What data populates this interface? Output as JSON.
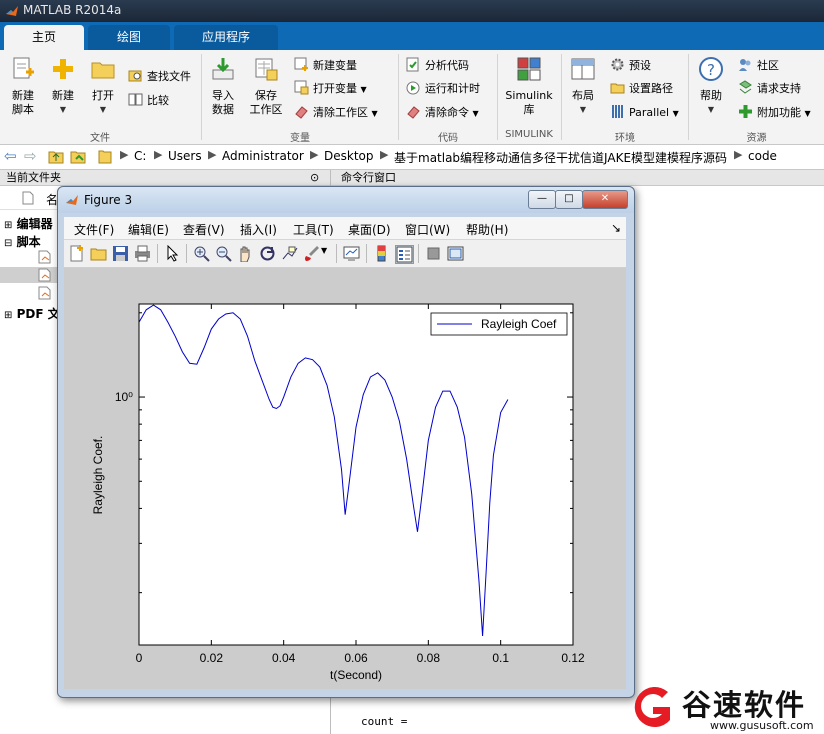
{
  "app": {
    "title": "MATLAB R2014a"
  },
  "ribbon_tabs": [
    "主页",
    "绘图",
    "应用程序"
  ],
  "ribbon": {
    "file": {
      "group": "文件",
      "new_script": [
        "新建",
        "脚本"
      ],
      "new": "新建",
      "open": "打开",
      "find_files": "查找文件",
      "compare": "比较"
    },
    "variable": {
      "group": "变量",
      "import": [
        "导入",
        "数据"
      ],
      "save_ws": [
        "保存",
        "工作区"
      ],
      "new_var": "新建变量",
      "open_var": "打开变量",
      "clear_ws": "清除工作区"
    },
    "code": {
      "group": "代码",
      "analyze": "分析代码",
      "run_time": "运行和计时",
      "clear_cmd": "清除命令"
    },
    "simulink": {
      "group": "SIMULINK",
      "lib": [
        "Simulink",
        "库"
      ]
    },
    "env": {
      "group": "环境",
      "layout": "布局",
      "prefs": "预设",
      "set_path": "设置路径",
      "parallel": "Parallel"
    },
    "resources": {
      "group": "资源",
      "help": "帮助",
      "community": "社区",
      "support": "请求支持",
      "addons": "附加功能"
    }
  },
  "address": [
    "C:",
    "Users",
    "Administrator",
    "Desktop",
    "基于matlab编程移动通信多径干扰信道JAKE模型建模程序源码",
    "code"
  ],
  "left_panel": {
    "header": "当前文件夹",
    "col_name": "名",
    "tree": [
      "编辑器",
      "脚本",
      "PDF 文"
    ]
  },
  "cmd_panel": {
    "header": "命令行窗口",
    "line": "count  ="
  },
  "figure": {
    "title": "Figure 3",
    "menus": [
      "文件(F)",
      "编辑(E)",
      "查看(V)",
      "插入(I)",
      "工具(T)",
      "桌面(D)",
      "窗口(W)",
      "帮助(H)"
    ],
    "menu_arrow": "↘",
    "window_buttons": [
      "—",
      "□",
      "✕"
    ]
  },
  "chart_data": {
    "type": "line",
    "title": "",
    "xlabel": "t(Second)",
    "ylabel": "Rayleigh Coef.",
    "yscale": "log",
    "xlim": [
      0,
      0.12
    ],
    "ylim": [
      0.13,
      2.15
    ],
    "xticks": [
      0,
      0.02,
      0.04,
      0.06,
      0.08,
      0.1,
      0.12
    ],
    "xtick_labels": [
      "0",
      "0.02",
      "0.04",
      "0.06",
      "0.08",
      "0.1",
      "0.12"
    ],
    "yticks": [
      1
    ],
    "ytick_labels": [
      "10⁰"
    ],
    "grid": false,
    "legend_position": "top-right",
    "series": [
      {
        "name": "Rayleigh Coef",
        "color": "#0000cc",
        "x": [
          0,
          0.002,
          0.004,
          0.006,
          0.008,
          0.01,
          0.012,
          0.014,
          0.016,
          0.018,
          0.02,
          0.022,
          0.024,
          0.026,
          0.028,
          0.03,
          0.032,
          0.034,
          0.036,
          0.037,
          0.038,
          0.039,
          0.04,
          0.042,
          0.044,
          0.046,
          0.048,
          0.05,
          0.052,
          0.054,
          0.056,
          0.057,
          0.058,
          0.06,
          0.062,
          0.064,
          0.066,
          0.068,
          0.07,
          0.072,
          0.074,
          0.076,
          0.077,
          0.078,
          0.08,
          0.082,
          0.084,
          0.086,
          0.088,
          0.09,
          0.092,
          0.094,
          0.095,
          0.096,
          0.097,
          0.098,
          0.1,
          0.102
        ],
        "y": [
          1.85,
          2.05,
          2.13,
          2.05,
          1.85,
          1.65,
          1.45,
          1.32,
          1.31,
          1.5,
          1.75,
          1.9,
          1.98,
          2.0,
          1.9,
          1.65,
          1.35,
          1.15,
          0.98,
          0.92,
          0.91,
          0.93,
          1.0,
          1.18,
          1.32,
          1.38,
          1.36,
          1.28,
          1.1,
          0.85,
          0.55,
          0.38,
          0.48,
          0.78,
          1.02,
          1.18,
          1.22,
          1.15,
          1.0,
          0.82,
          0.6,
          0.4,
          0.33,
          0.42,
          0.7,
          0.92,
          1.05,
          1.05,
          0.92,
          0.72,
          0.45,
          0.22,
          0.14,
          0.24,
          0.42,
          0.62,
          0.88,
          0.98
        ]
      }
    ]
  },
  "watermark": {
    "brand": "谷速软件",
    "url": "www.gususoft.com"
  },
  "colors": {
    "accent": "#0e6ab4",
    "line": "#0000cc",
    "title_bar": "#1f2d3f"
  }
}
